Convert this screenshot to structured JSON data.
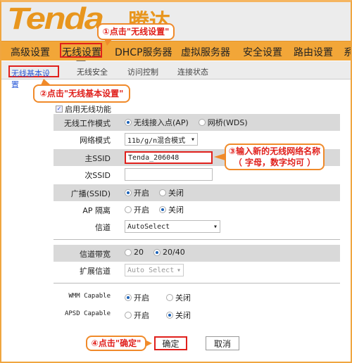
{
  "brand": {
    "logo": "Tenda",
    "logo_cn": "腾达",
    "color": "#e8961e"
  },
  "nav": {
    "items": [
      "高级设置",
      "无线设置",
      "DHCP服务器",
      "虚拟服务器",
      "安全设置",
      "路由设置",
      "系"
    ]
  },
  "subnav": {
    "items": [
      "无线基本设置",
      "无线安全",
      "访问控制",
      "连接状态"
    ]
  },
  "callouts": {
    "c1": "①点击\"无线设置\"",
    "c2": "②点击\"无线基本设置\"",
    "c3_line1": "③输入新的无线网络名称",
    "c3_line2": "（ 字母，数字均可 ）",
    "c4": "④点击\"确定\""
  },
  "form": {
    "enable_label": "启用无线功能",
    "enable_checked": true,
    "mode_label": "无线工作模式",
    "mode_options": [
      "无线接入点(AP)",
      "网桥(WDS)"
    ],
    "mode_selected": 0,
    "netmode_label": "网络模式",
    "netmode_value": "11b/g/n混合模式",
    "ssid1_label": "主SSID",
    "ssid1_value": "Tenda_206048",
    "ssid2_label": "次SSID",
    "ssid2_value": "",
    "broadcast_label": "广播(SSID)",
    "on": "开启",
    "off": "关闭",
    "broadcast_selected": 0,
    "apiso_label": "AP 隔离",
    "apiso_selected": 1,
    "channel_label": "信道",
    "channel_value": "AutoSelect",
    "bw_label": "信道带宽",
    "bw_options": [
      "20",
      "20/40"
    ],
    "bw_selected": 1,
    "ext_label": "扩展信道",
    "ext_value": "Auto Select",
    "wmm_label": "WMM Capable",
    "wmm_selected": 0,
    "apsd_label": "APSD Capable",
    "apsd_selected": 1
  },
  "buttons": {
    "ok": "确定",
    "cancel": "取消"
  }
}
